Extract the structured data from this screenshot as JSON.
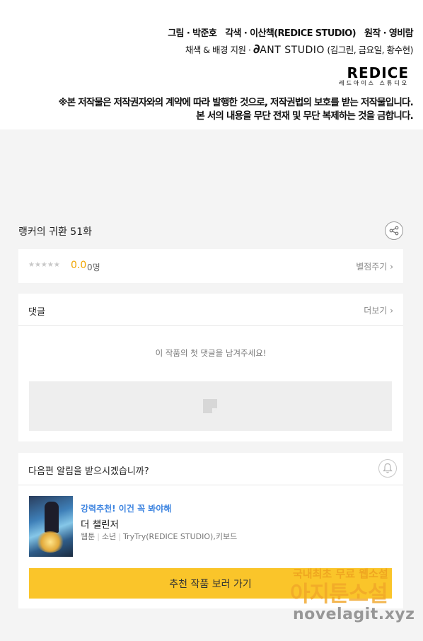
{
  "credits": {
    "line1": [
      "그림 · 박준호",
      "각색 · 이산책(REDICE STUDIO)",
      "원작 · 영비람"
    ],
    "line2_prefix": "채색 & 배경 지원 · ",
    "line2_sig": "∂",
    "line2_studio": "ANT STUDIO",
    "line2_suffix": " (김그린, 금요일, 황수현)",
    "logo_mark": "REDICE",
    "logo_sub": "레드아이스 스튜디오",
    "notice_1": "※본 저작물은 저작권자와의 계약에 따라 발행한 것으로, 저작권법의 보호를 받는 저작물입니다.",
    "notice_2": "본 서의 내용을 무단 전재 및 무단 복제하는 것을 금합니다."
  },
  "episode": {
    "title": "랭커의 귀환 51화",
    "share_icon": "share-icon"
  },
  "rating": {
    "stars": "★★★★★",
    "score": "0.0",
    "count": "0명",
    "rate_label": "별점주기 ›"
  },
  "comments": {
    "label": "댓글",
    "more_label": "더보기 ›",
    "empty_message": "이 작품의 첫 댓글을 남겨주세요!"
  },
  "recommend": {
    "question": "다음편 알림을 받으시겠습니까?",
    "tagline": "강력추천! 이건 꼭 봐야해",
    "work_title": "더 챌린저",
    "genre": "웹툰",
    "category": "소년",
    "authors": "TryTry(REDICE STUDIO),키보드",
    "cta_label": "추천 작품 보러 가기"
  },
  "watermark": {
    "line1": "국내최초 무료 웹소설",
    "line2": "아지툰소설",
    "line3": "novelagit.xyz"
  }
}
